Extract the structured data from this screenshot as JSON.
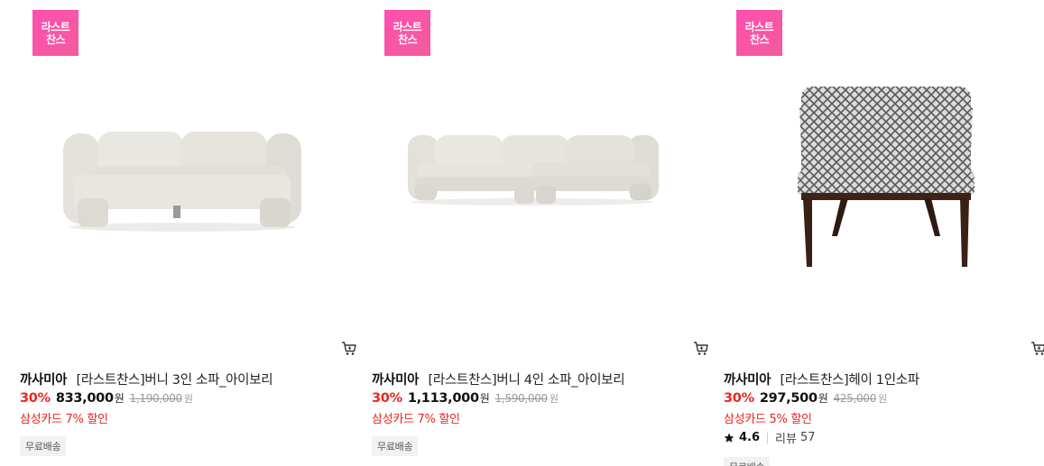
{
  "products": [
    {
      "badge_line1": "라스트",
      "badge_line2": "찬스",
      "brand": "까사미아",
      "name": "[라스트찬스]버니 3인 소파_아이보리",
      "discount": "30%",
      "price": "833,000",
      "price_unit": "원",
      "original_price": "1,190,000",
      "original_unit": "원",
      "card_promo": "삼성카드 7% 할인",
      "tag": "무료배송"
    },
    {
      "badge_line1": "라스트",
      "badge_line2": "찬스",
      "brand": "까사미아",
      "name": "[라스트찬스]버니 4인 소파_아이보리",
      "discount": "30%",
      "price": "1,113,000",
      "price_unit": "원",
      "original_price": "1,590,000",
      "original_unit": "원",
      "card_promo": "삼성카드 7% 할인",
      "tag": "무료배송"
    },
    {
      "badge_line1": "라스트",
      "badge_line2": "찬스",
      "brand": "까사미아",
      "name": "[라스트찬스]헤이 1인소파",
      "discount": "30%",
      "price": "297,500",
      "price_unit": "원",
      "original_price": "425,000",
      "original_unit": "원",
      "card_promo": "삼성카드 5% 할인",
      "rating": "4.6",
      "review_label": "리뷰",
      "review_count": "57",
      "tag": "무료배송"
    }
  ],
  "icons": {
    "cart": "cart-icon",
    "star": "star-icon"
  },
  "colors": {
    "badge": "#f25c9c",
    "discount": "#e8261c",
    "promo": "#e8261c",
    "strike": "#999999"
  }
}
